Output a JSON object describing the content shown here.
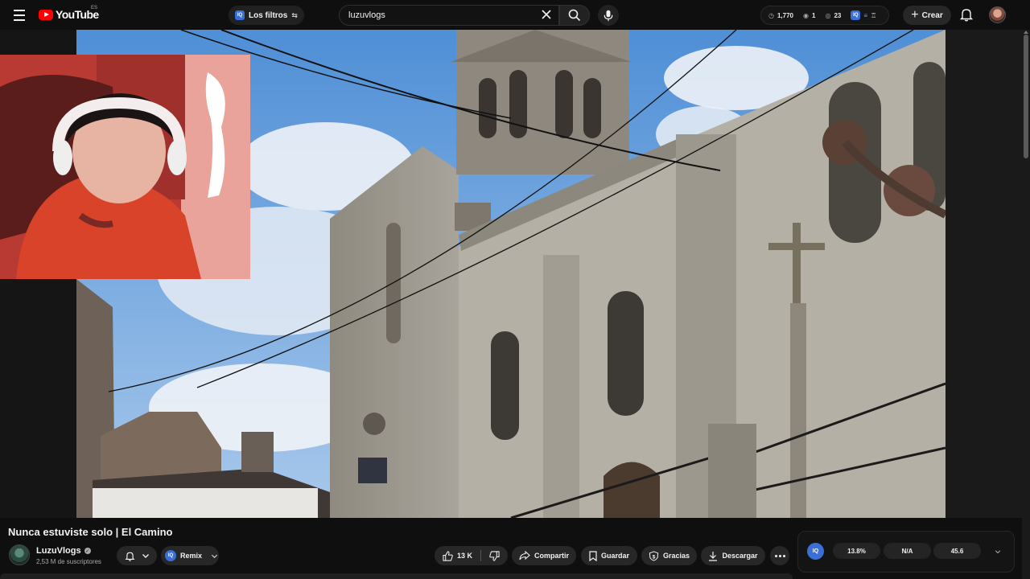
{
  "header": {
    "logo_text": "YouTube",
    "country_code": "ES",
    "filters_label": "Los filtros",
    "search_value": "luzuvlogs",
    "stats": {
      "views": "1,770",
      "watching": "1",
      "viewers": "23"
    },
    "create_label": "Crear"
  },
  "video": {
    "title": "Nunca estuviste solo | El Camino"
  },
  "channel": {
    "name": "LuzuVlogs",
    "subscribers": "2,53 M de suscriptores"
  },
  "actions": {
    "remix_label": "Remix",
    "like_count": "13 K",
    "share_label": "Compartir",
    "save_label": "Guardar",
    "thanks_label": "Gracias",
    "download_label": "Descargar"
  },
  "metrics": {
    "badge": "IQ",
    "values": [
      "13.8%",
      "N/A",
      "45.6"
    ]
  },
  "icons": [
    "menu-icon",
    "youtube-logo-icon",
    "filter-swap-icon",
    "clear-icon",
    "search-icon",
    "mic-icon",
    "eye-icon",
    "clock-icon",
    "create-plus-icon",
    "bell-icon",
    "verified-icon",
    "like-icon",
    "dislike-icon",
    "share-icon",
    "save-icon",
    "thanks-icon",
    "download-icon",
    "more-icon",
    "chevron-down-icon"
  ],
  "colors": {
    "background": "#0f0f0f",
    "brand_red": "#ff0000",
    "chip": "#272727",
    "iq_blue": "#3b6fd8",
    "text": "#f1f1f1",
    "muted": "#aaaaaa"
  }
}
